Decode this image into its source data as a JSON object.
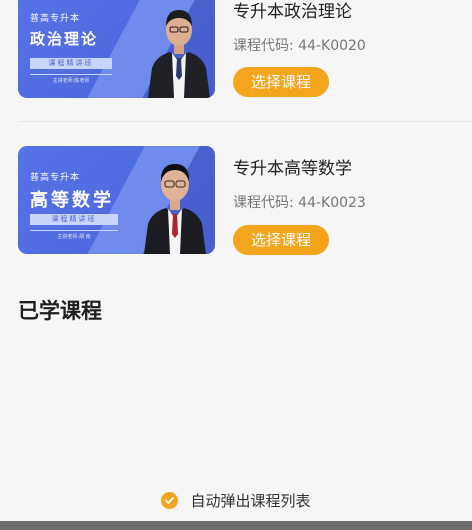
{
  "courses": [
    {
      "thumb_tag": "普高专升本",
      "thumb_title": "政治理论",
      "thumb_subtitle": "课程精讲班",
      "thumb_teacher": "主讲老师:陈老师",
      "title": "专升本政治理论",
      "code": "课程代码: 44-K0020",
      "button": "选择课程"
    },
    {
      "thumb_tag": "普高专升本",
      "thumb_title": "高等数学",
      "thumb_subtitle": "课程精讲班",
      "thumb_teacher": "主讲老师:胡 南",
      "title": "专升本高等数学",
      "code": "课程代码: 44-K0023",
      "button": "选择课程"
    }
  ],
  "studied_section": {
    "title": "已学课程"
  },
  "auto_popup": {
    "label": "自动弹出课程列表",
    "checked": true
  },
  "colors": {
    "accent": "#f2a51d",
    "thumb_blue": "#4a63d8",
    "background": "#f6f6f6"
  },
  "icons": {
    "checkbox": "check-circle-icon"
  }
}
